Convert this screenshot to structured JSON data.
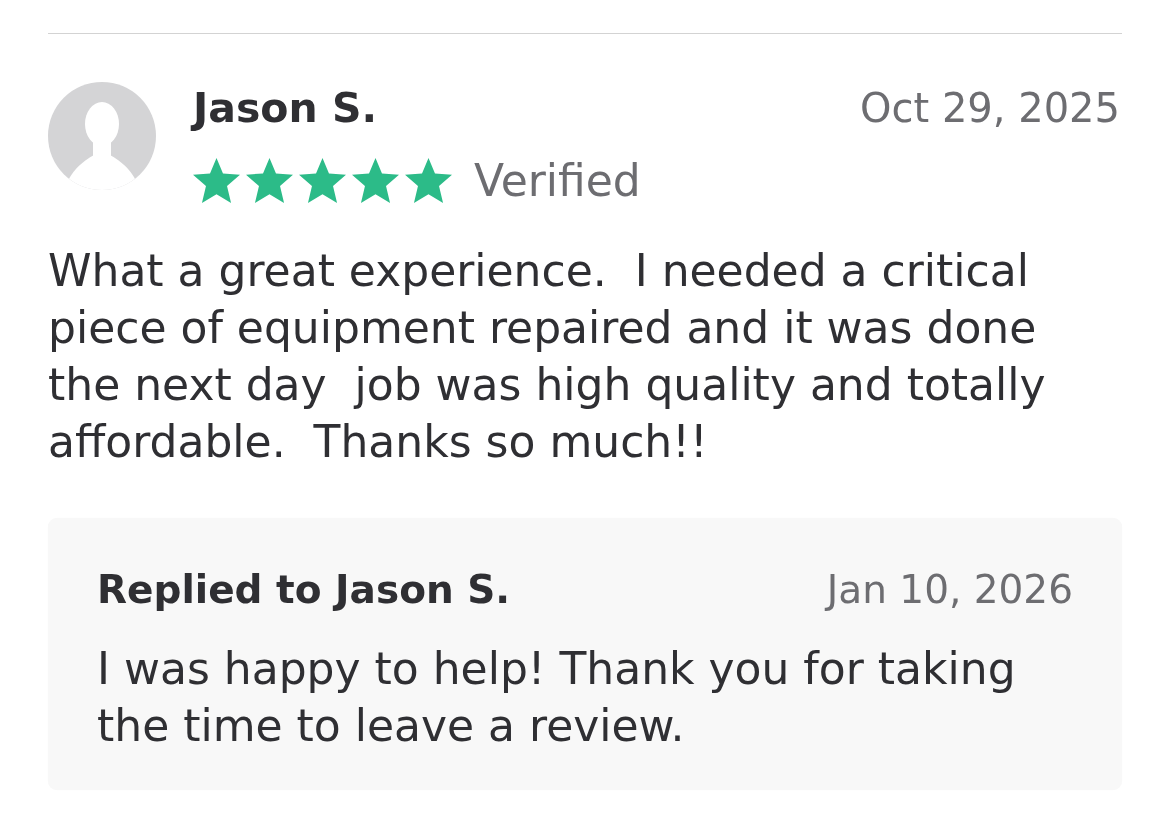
{
  "review": {
    "author": "Jason S.",
    "date": "Oct 29, 2025",
    "stars": 5,
    "badge": "Verified",
    "text": "What a great experience.  I needed a critical piece of equipment repaired and it was done the next day  job was high quality and totally affordable.  Thanks so much!!"
  },
  "reply": {
    "title": "Replied to Jason S.",
    "date": "Jan 10, 2026",
    "text": "I was happy to help! Thank you for taking the time to leave a review."
  }
}
